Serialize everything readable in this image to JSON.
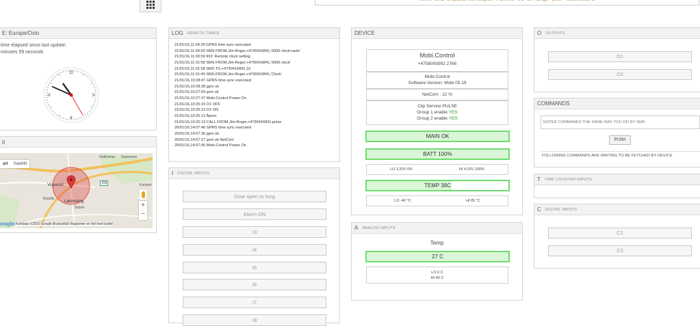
{
  "toolbar": {
    "help_text": "Move and Expand/Collapse Panels to arrange your Dashboard"
  },
  "time_panel": {
    "title": "E: Europe/Oslo",
    "elapsed_label": "time elapsed since last update:",
    "elapsed_value": "minutes 59 seconds",
    "clock": {
      "hour": 10,
      "minute": 49,
      "second": 25,
      "numerals": [
        "12",
        "3",
        "6",
        "9"
      ]
    }
  },
  "map_panel": {
    "title": "p",
    "btn_map": "art",
    "btn_satellite": "Satellitt",
    "places": [
      "Fjellhamar",
      "Strømmen",
      "Visperud",
      "Lørenskog",
      "Skårer",
      "Raykås",
      "Kurland",
      "159"
    ],
    "marker_label": "Lørenskog",
    "zoom_in": "+",
    "zoom_out": "−",
    "logo": "oogle",
    "footer": "Kartdata ©2016 Google   Bruksvilkår   Rapporter en feil med kartet"
  },
  "log_panel": {
    "title": "LOG",
    "subtitle": "REMOTE TRACE",
    "lines": [
      "21/01/16,11:04:29 GPRS time sync executed",
      "21/01/16,11:04:00 SMS FROM,Jim-Roger,+4790416841,'0000 clock+auto'",
      "21/01/16,11:03:59 902: Remote clock setting",
      "21/01/16,11:01:58 SMS FROM,Jim-Roger,+4790416841,'0000 clock'",
      "21/01/16,11:01:58 SMS TO,+4790416841,16",
      "21/01/16,11:01:49 SMS FROM,Jim-Roger,+4790416841,'Clock'",
      "21/01/16,10:28:47 GPRS time sync executed",
      "21/01/16,10:28:28 gprs ok",
      "21/01/16,10:27:59 gsm ok",
      "21/01/16,10:27:37 Mobi.Control Power On",
      "21/01/16,10:25:15 O1 OFF",
      "21/01/16,10:25:13 O1 ON",
      "21/01/16,10:25:13 Åpner",
      "21/01/16,10:25:13 CALL FROM,Jim-Roger,+4790416841,pulse",
      "20/01/16,14:07:46 GPRS time sync executed",
      "20/01/16,14:07:35 gprs ok",
      "20/01/16,14:07:27 gsm ok NetCom",
      "20/01/16,14:07:06 Mobi.Control Power On"
    ]
  },
  "digital_inputs_panel": {
    "title": "I",
    "subtitle": "DIGITAL INPUTS",
    "inputs": [
      "Door open to long",
      "Alarm ON",
      "I3",
      "I4",
      "I5",
      "I6",
      "I7",
      "I8"
    ]
  },
  "device_panel": {
    "title": "DEVICE",
    "name": "Mobi.Control",
    "phone": "+4758000992 2766",
    "product": "Mobi.Control",
    "software": "Software Version: Mobi 05.19",
    "netcom": "NetCom :  22 %",
    "clip": "Clip Service PULSE",
    "group1": "Group 1 enable ",
    "group2": "Group 2 enable ",
    "yes": "YES",
    "main": "MAIN OK",
    "batt": "BATT 100%",
    "batt_lo": "LO 3.20V 0%",
    "batt_hi": "HI 4.20V 100%",
    "temp": "TEMP 38C",
    "temp_fill": 0.6,
    "temp_lo": "LO -40 °C",
    "temp_hi": "HI 85 °C"
  },
  "analog_panel": {
    "title": "A",
    "subtitle": "ANALOG INPUTS",
    "label": "Temp",
    "value": "27 C",
    "lo": "LO 0 C",
    "hi": "HI 40 C"
  },
  "outputs_panel": {
    "title": "O",
    "subtitle": "OUTPUTS",
    "outputs": [
      "O1",
      "O2"
    ]
  },
  "commands_panel": {
    "title": "COMMANDS",
    "placeholder": "ENTER COMMANDS THE SAME WAY YOU DO BY SMS",
    "push": "PUSH",
    "waiting": "FOLLOWING COMMANDS ARE WAITING TO BE FETCHED BY DEVICE"
  },
  "time_counter_panel": {
    "title": "T",
    "subtitle": "TIME COUNTER INPUTS"
  },
  "counter_inputs_panel": {
    "title": "C",
    "subtitle": "DIGITAL INPUTS",
    "counters": [
      "C1",
      "C2"
    ]
  },
  "colors": {
    "green_border": "#6fdc6f",
    "green_fill": "#d9f7d6",
    "marker": "#e03a3a"
  }
}
